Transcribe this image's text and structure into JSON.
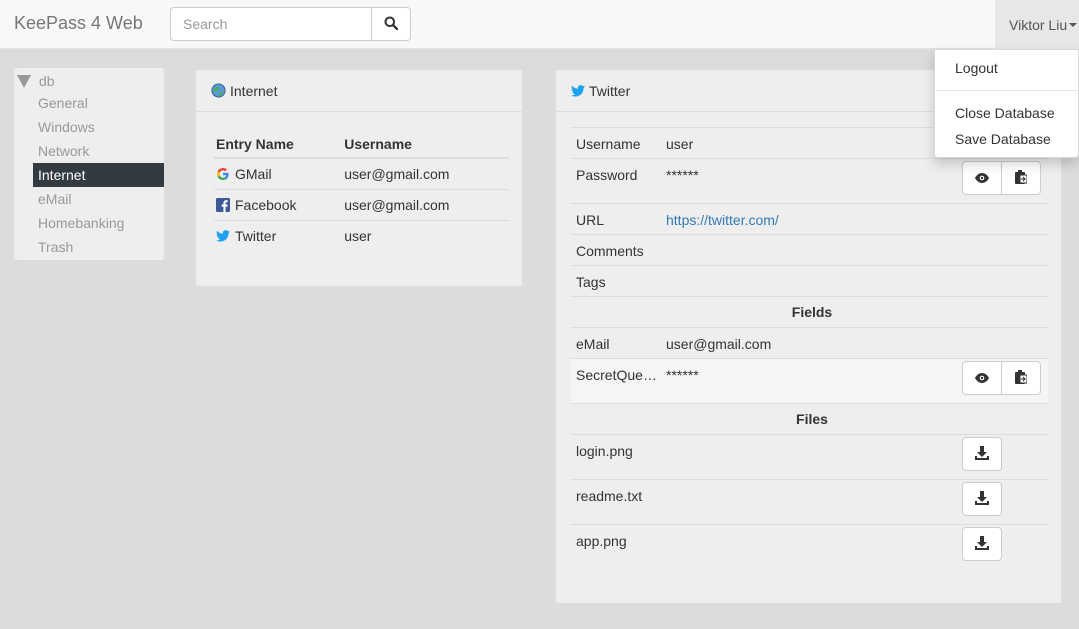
{
  "app": {
    "title": "KeePass 4 Web"
  },
  "search": {
    "placeholder": "Search",
    "icon": "search-icon"
  },
  "user": {
    "name": "Viktor Liu"
  },
  "user_menu": {
    "logout": "Logout",
    "close_db": "Close Database",
    "save_db": "Save Database"
  },
  "tree": {
    "root": "db",
    "items": [
      "General",
      "Windows",
      "Network",
      "Internet",
      "eMail",
      "Homebanking",
      "Trash"
    ],
    "active": "Internet"
  },
  "group_panel": {
    "title": "Internet",
    "headers": {
      "name": "Entry Name",
      "user": "Username"
    },
    "entries": [
      {
        "name": "GMail",
        "user": "user@gmail.com",
        "icon": "google-icon"
      },
      {
        "name": "Facebook",
        "user": "user@gmail.com",
        "icon": "facebook-icon"
      },
      {
        "name": "Twitter",
        "user": "user",
        "icon": "twitter-icon"
      }
    ]
  },
  "entry": {
    "title": "Twitter",
    "username_label": "Username",
    "username": "user",
    "password_label": "Password",
    "password": "******",
    "url_label": "URL",
    "url": "https://twitter.com/",
    "comments_label": "Comments",
    "tags_label": "Tags",
    "fields_heading": "Fields",
    "fields": [
      {
        "label": "eMail",
        "value": "user@gmail.com"
      },
      {
        "label": "SecretQuestion",
        "value": "******"
      }
    ],
    "files_heading": "Files",
    "files": [
      "login.png",
      "readme.txt",
      "app.png"
    ]
  },
  "colors": {
    "accent": "#337ab7",
    "active_bg": "#333a40",
    "twitter": "#1da1f2",
    "facebook": "#3b5998"
  }
}
